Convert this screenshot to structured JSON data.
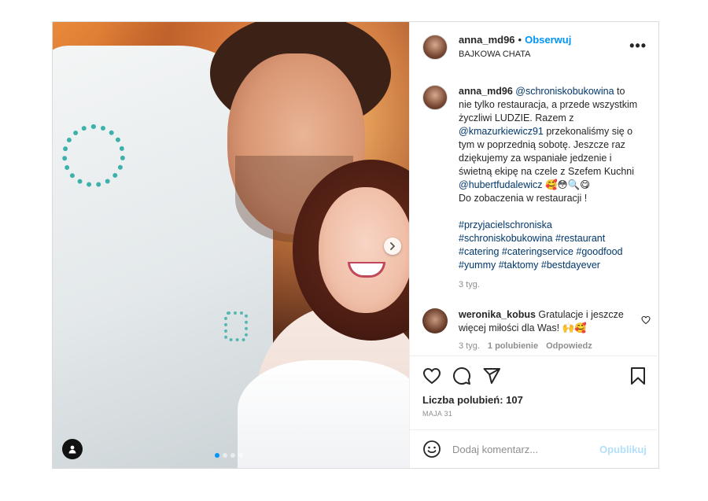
{
  "post": {
    "username": "anna_md96",
    "separator": "•",
    "follow_label": "Obserwuj",
    "location": "BAJKOWA CHATA",
    "more_label": "•••"
  },
  "caption": {
    "username": "anna_md96",
    "mention1": "@schroniskobukowina",
    "text1": " to nie tylko restauracja, a przede wszystkim życzliwi LUDZIE. Razem z ",
    "mention2": "@kmazurkiewicz91",
    "text2": " przekonaliśmy się o tym w poprzednią sobotę. Jeszcze raz dziękujemy za wspaniałe jedzenie i świetną ekipę na czele z Szefem Kuchni ",
    "mention3": "@hubertfudalewicz",
    "emojis": " 🥰😳🔍😋",
    "text3": "Do zobaczenia w restauracji !",
    "hashtags_line1": "#przyjacielschroniska",
    "hashtags_line2": "#schroniskobukowina #restaurant",
    "hashtags_line3": "#catering #cateringservice #goodfood",
    "hashtags_line4": "#yummy #taktomy #bestdayever",
    "time": "3 tyg."
  },
  "comment": {
    "username": "weronika_kobus",
    "text": " Gratulacje i jeszcze więcej miłości dla Was! 🙌🥰",
    "time": "3 tyg.",
    "likes": "1 polubienie",
    "reply": "Odpowiedz"
  },
  "actions": {
    "likes_label": "Liczba polubień: 107",
    "date": "MAJA 31"
  },
  "add_comment": {
    "placeholder": "Dodaj komentarz...",
    "post_label": "Opublikuj"
  },
  "carousel": {
    "current": 1,
    "total": 4
  },
  "colors": {
    "link": "#00376b",
    "accent": "#0095f6",
    "muted": "#8e8e8e"
  }
}
